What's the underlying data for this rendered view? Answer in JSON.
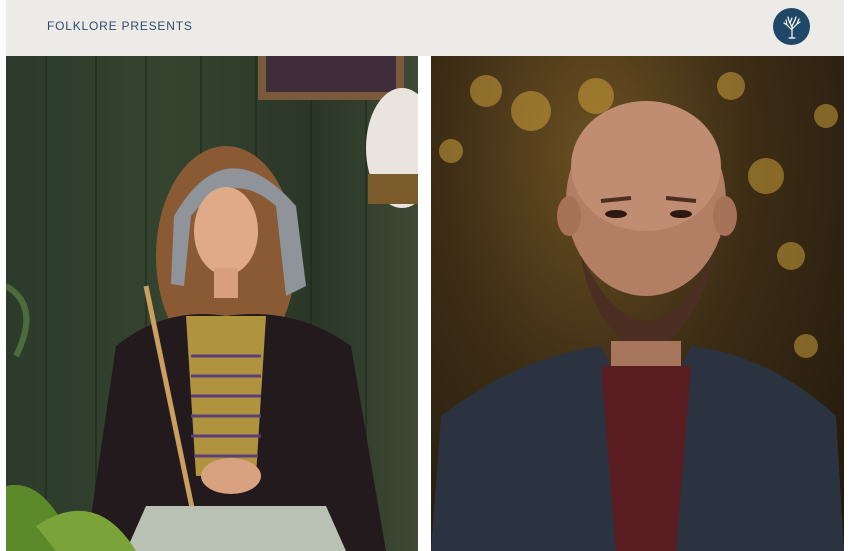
{
  "header": {
    "brand_text": "FOLKLORE PRESENTS",
    "logo_icon": "tree-logo-icon"
  },
  "colors": {
    "header_bg": "#ecebe7",
    "brand_text": "#2f4a6c",
    "logo_bg": "#1f4868"
  },
  "photos": {
    "left": {
      "subject": "woman-in-hooded-velvet-robe-portrait"
    },
    "right": {
      "subject": "bearded-man-portrait"
    }
  }
}
